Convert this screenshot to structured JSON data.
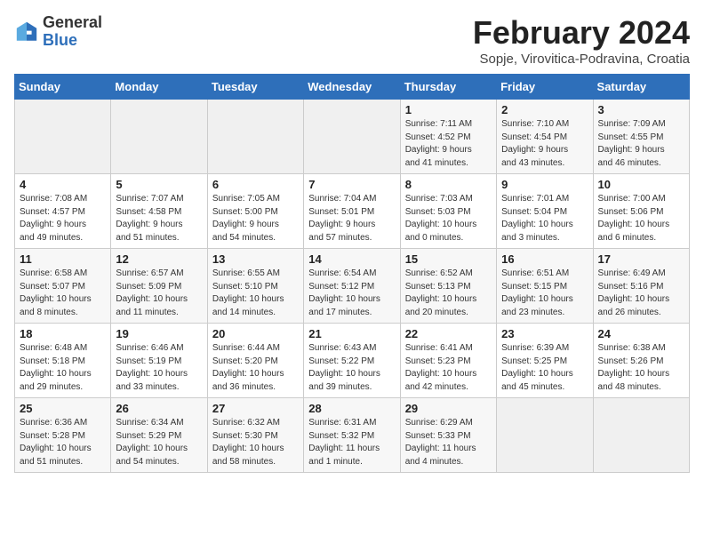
{
  "header": {
    "logo": {
      "general": "General",
      "blue": "Blue",
      "tagline": ""
    },
    "title": "February 2024",
    "subtitle": "Sopje, Virovitica-Podravina, Croatia"
  },
  "columns": [
    "Sunday",
    "Monday",
    "Tuesday",
    "Wednesday",
    "Thursday",
    "Friday",
    "Saturday"
  ],
  "weeks": [
    [
      {
        "day": "",
        "detail": ""
      },
      {
        "day": "",
        "detail": ""
      },
      {
        "day": "",
        "detail": ""
      },
      {
        "day": "",
        "detail": ""
      },
      {
        "day": "1",
        "detail": "Sunrise: 7:11 AM\nSunset: 4:52 PM\nDaylight: 9 hours\nand 41 minutes."
      },
      {
        "day": "2",
        "detail": "Sunrise: 7:10 AM\nSunset: 4:54 PM\nDaylight: 9 hours\nand 43 minutes."
      },
      {
        "day": "3",
        "detail": "Sunrise: 7:09 AM\nSunset: 4:55 PM\nDaylight: 9 hours\nand 46 minutes."
      }
    ],
    [
      {
        "day": "4",
        "detail": "Sunrise: 7:08 AM\nSunset: 4:57 PM\nDaylight: 9 hours\nand 49 minutes."
      },
      {
        "day": "5",
        "detail": "Sunrise: 7:07 AM\nSunset: 4:58 PM\nDaylight: 9 hours\nand 51 minutes."
      },
      {
        "day": "6",
        "detail": "Sunrise: 7:05 AM\nSunset: 5:00 PM\nDaylight: 9 hours\nand 54 minutes."
      },
      {
        "day": "7",
        "detail": "Sunrise: 7:04 AM\nSunset: 5:01 PM\nDaylight: 9 hours\nand 57 minutes."
      },
      {
        "day": "8",
        "detail": "Sunrise: 7:03 AM\nSunset: 5:03 PM\nDaylight: 10 hours\nand 0 minutes."
      },
      {
        "day": "9",
        "detail": "Sunrise: 7:01 AM\nSunset: 5:04 PM\nDaylight: 10 hours\nand 3 minutes."
      },
      {
        "day": "10",
        "detail": "Sunrise: 7:00 AM\nSunset: 5:06 PM\nDaylight: 10 hours\nand 6 minutes."
      }
    ],
    [
      {
        "day": "11",
        "detail": "Sunrise: 6:58 AM\nSunset: 5:07 PM\nDaylight: 10 hours\nand 8 minutes."
      },
      {
        "day": "12",
        "detail": "Sunrise: 6:57 AM\nSunset: 5:09 PM\nDaylight: 10 hours\nand 11 minutes."
      },
      {
        "day": "13",
        "detail": "Sunrise: 6:55 AM\nSunset: 5:10 PM\nDaylight: 10 hours\nand 14 minutes."
      },
      {
        "day": "14",
        "detail": "Sunrise: 6:54 AM\nSunset: 5:12 PM\nDaylight: 10 hours\nand 17 minutes."
      },
      {
        "day": "15",
        "detail": "Sunrise: 6:52 AM\nSunset: 5:13 PM\nDaylight: 10 hours\nand 20 minutes."
      },
      {
        "day": "16",
        "detail": "Sunrise: 6:51 AM\nSunset: 5:15 PM\nDaylight: 10 hours\nand 23 minutes."
      },
      {
        "day": "17",
        "detail": "Sunrise: 6:49 AM\nSunset: 5:16 PM\nDaylight: 10 hours\nand 26 minutes."
      }
    ],
    [
      {
        "day": "18",
        "detail": "Sunrise: 6:48 AM\nSunset: 5:18 PM\nDaylight: 10 hours\nand 29 minutes."
      },
      {
        "day": "19",
        "detail": "Sunrise: 6:46 AM\nSunset: 5:19 PM\nDaylight: 10 hours\nand 33 minutes."
      },
      {
        "day": "20",
        "detail": "Sunrise: 6:44 AM\nSunset: 5:20 PM\nDaylight: 10 hours\nand 36 minutes."
      },
      {
        "day": "21",
        "detail": "Sunrise: 6:43 AM\nSunset: 5:22 PM\nDaylight: 10 hours\nand 39 minutes."
      },
      {
        "day": "22",
        "detail": "Sunrise: 6:41 AM\nSunset: 5:23 PM\nDaylight: 10 hours\nand 42 minutes."
      },
      {
        "day": "23",
        "detail": "Sunrise: 6:39 AM\nSunset: 5:25 PM\nDaylight: 10 hours\nand 45 minutes."
      },
      {
        "day": "24",
        "detail": "Sunrise: 6:38 AM\nSunset: 5:26 PM\nDaylight: 10 hours\nand 48 minutes."
      }
    ],
    [
      {
        "day": "25",
        "detail": "Sunrise: 6:36 AM\nSunset: 5:28 PM\nDaylight: 10 hours\nand 51 minutes."
      },
      {
        "day": "26",
        "detail": "Sunrise: 6:34 AM\nSunset: 5:29 PM\nDaylight: 10 hours\nand 54 minutes."
      },
      {
        "day": "27",
        "detail": "Sunrise: 6:32 AM\nSunset: 5:30 PM\nDaylight: 10 hours\nand 58 minutes."
      },
      {
        "day": "28",
        "detail": "Sunrise: 6:31 AM\nSunset: 5:32 PM\nDaylight: 11 hours\nand 1 minute."
      },
      {
        "day": "29",
        "detail": "Sunrise: 6:29 AM\nSunset: 5:33 PM\nDaylight: 11 hours\nand 4 minutes."
      },
      {
        "day": "",
        "detail": ""
      },
      {
        "day": "",
        "detail": ""
      }
    ]
  ]
}
